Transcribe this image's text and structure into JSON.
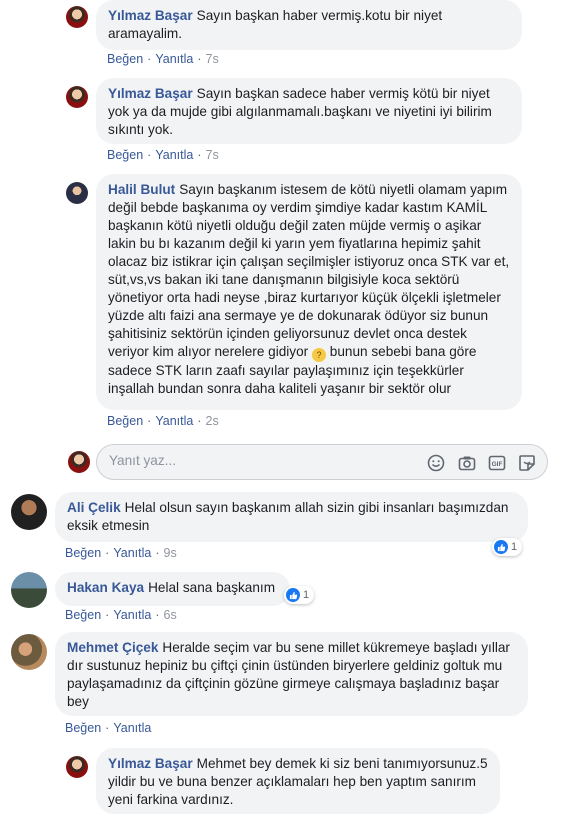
{
  "ui": {
    "like_label": "Beğen",
    "reply_label": "Yanıtla",
    "reply_placeholder": "Yanıt yaz...",
    "separator": "·"
  },
  "comments": [
    {
      "author": "Yılmaz Başar",
      "text": "Sayın başkan haber vermiş.kotu bir niyet aramayalim.",
      "time": "7s"
    },
    {
      "author": "Yılmaz Başar",
      "text": "Sayın başkan sadece haber vermiş kötü bir niyet yok ya da mujde gibi algılanmamalı.başkanı ve niyetini iyi bilirim sıkıntı yok.",
      "time": "7s"
    },
    {
      "author": "Halil Bulut",
      "text": "Sayın başkanım istesem de kötü niyetli olamam yapım değil bebde başkanıma oy verdim şimdiye kadar kastım KAMİL başkanın kötü niyetli olduğu değil zaten müjde vermiş o aşikar lakin bu bı kazanım değil ki yarın yem fiyatlarına hepimiz şahit olacaz biz istikrar için çalışan seçilmişler istiyoruz onca STK var et, süt,vs,vs bakan iki tane danışmanın bilgisiyle koca sektörü yönetiyor orta hadi neyse ,biraz kurtarıyor küçük ölçekli işletmeler yüzde altı faizi ana sermaye ye de dokunarak ödüyor siz bunun şahitisiniz sektörün içinden geliyorsunuz devlet onca destek veriyor kim alıyor nerelere gidiyor",
      "text2": "bunun sebebi bana göre sadece STK ların zaafı sayılar paylaşımınız için teşekkürler inşallah bundan sonra daha kaliteli yaşanır bir sektör olur",
      "time": "2s"
    },
    {
      "author": "Ali Çelik",
      "text": "Helal olsun sayın başkanım allah sizin gibi insanları başımızdan eksik etmesin",
      "time": "9s",
      "likes": "1"
    },
    {
      "author": "Hakan Kaya",
      "text": "Helal sana başkanım",
      "time": "6s",
      "likes": "1"
    },
    {
      "author": "Mehmet Çiçek",
      "text": "Heralde seçim var bu sene millet kükremeye başladı yıllar dır sustunuz hepiniz bu çiftçi çinin üstünden biryerlere geldiniz goltuk mu paylaşamadınız da çiftçinin gözüne girmeye calışmaya başladınız başar bey",
      "time": ""
    },
    {
      "author": "Yılmaz Başar",
      "text": "Mehmet bey demek ki siz beni tanımıyorsunuz.5 yildir bu ve buna benzer açıklamaları hep ben yaptım sanırım yeni farkina vardınız.",
      "time": ""
    }
  ],
  "colors": {
    "link": "#385898",
    "bubble": "#f2f3f5",
    "like": "#1877f2"
  },
  "icons": [
    "emoji-icon",
    "camera-icon",
    "gif-icon",
    "sticker-icon",
    "thumbs-up-icon",
    "thinking-emoji-icon"
  ]
}
